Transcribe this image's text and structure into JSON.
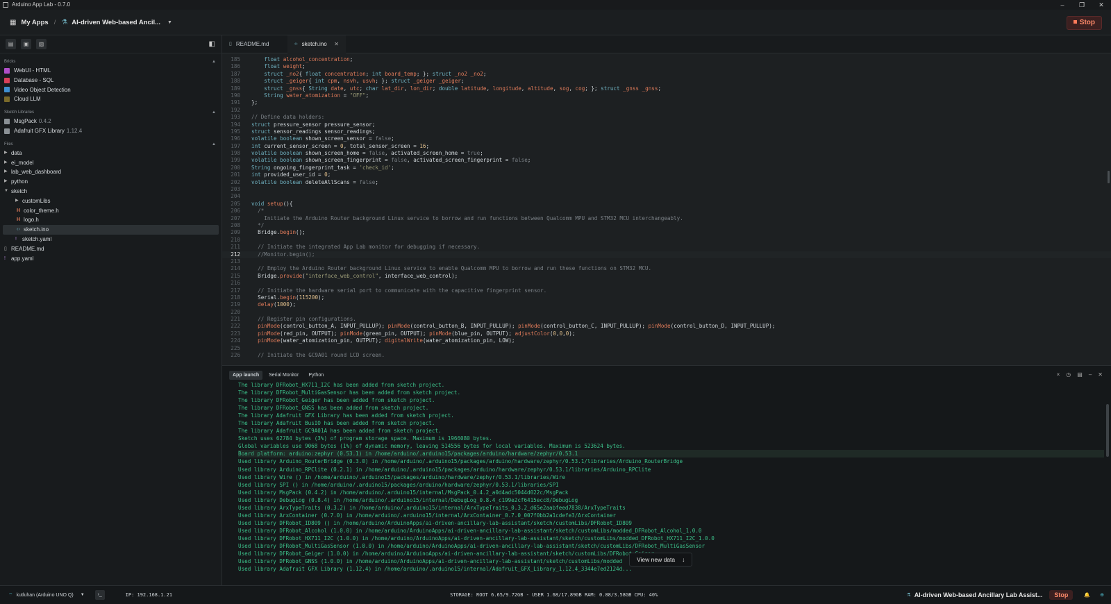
{
  "window": {
    "title": "Arduino App Lab - 0.7.0",
    "minimize": "–",
    "restore": "❐",
    "close": "✕"
  },
  "appbar": {
    "my_apps": "My Apps",
    "separator": "/",
    "app_name": "AI-driven Web-based Ancil...",
    "stop": "Stop"
  },
  "sidebar": {
    "bricks_title": "Bricks",
    "bricks": [
      {
        "label": "WebUI - HTML",
        "color": "#b04fc8"
      },
      {
        "label": "Database - SQL",
        "color": "#d8405a"
      },
      {
        "label": "Video Object Detection",
        "color": "#3f8fd0"
      },
      {
        "label": "Cloud LLM",
        "color": "#7a6a2a"
      }
    ],
    "libs_title": "Sketch Libraries",
    "libs": [
      {
        "name": "MsgPack",
        "version": "0.4.2"
      },
      {
        "name": "Adafruit GFX Library",
        "version": "1.12.4"
      }
    ],
    "files_title": "Files",
    "files": {
      "data": "data",
      "ei_model": "ei_model",
      "lab_web_dashboard": "lab_web_dashboard",
      "python": "python",
      "sketch": "sketch",
      "customLibs": "customLibs",
      "color_theme": "color_theme.h",
      "logo": "logo.h",
      "sketch_ino": "sketch.ino",
      "sketch_yaml": "sketch.yaml",
      "readme": "README.md",
      "app_yaml": "app.yaml"
    }
  },
  "tabs": [
    {
      "label": "README.md"
    },
    {
      "label": "sketch.ino"
    }
  ],
  "code": {
    "first_line": 185,
    "current_line": 212,
    "lines": [
      [
        [
          "    "
        ],
        [
          "float ",
          "k"
        ],
        [
          "alcohol_concentration",
          "fl"
        ],
        [
          ";"
        ]
      ],
      [
        [
          "    "
        ],
        [
          "float ",
          "k"
        ],
        [
          "weight",
          "fl"
        ],
        [
          ";"
        ]
      ],
      [
        [
          "    "
        ],
        [
          "struct ",
          "k"
        ],
        [
          "_no2",
          "fl"
        ],
        [
          "{ "
        ],
        [
          "float ",
          "k"
        ],
        [
          "concentration",
          "fl"
        ],
        [
          "; "
        ],
        [
          "int ",
          "k"
        ],
        [
          "board_temp",
          "fl"
        ],
        [
          "; }; "
        ],
        [
          "struct ",
          "k"
        ],
        [
          "_no2 _no2",
          "fl"
        ],
        [
          ";"
        ]
      ],
      [
        [
          "    "
        ],
        [
          "struct ",
          "k"
        ],
        [
          "_geiger",
          "fl"
        ],
        [
          "{ "
        ],
        [
          "int ",
          "k"
        ],
        [
          "cpm",
          "fl"
        ],
        [
          ", "
        ],
        [
          "nsvh",
          "fl"
        ],
        [
          ", "
        ],
        [
          "usvh",
          "fl"
        ],
        [
          "; }; "
        ],
        [
          "struct ",
          "k"
        ],
        [
          "_geiger _geiger",
          "fl"
        ],
        [
          ";"
        ]
      ],
      [
        [
          "    "
        ],
        [
          "struct ",
          "k"
        ],
        [
          "_gnss",
          "fl"
        ],
        [
          "{ "
        ],
        [
          "String ",
          "k"
        ],
        [
          "date",
          "fl"
        ],
        [
          ", "
        ],
        [
          "utc",
          "fl"
        ],
        [
          "; "
        ],
        [
          "char ",
          "k"
        ],
        [
          "lat_dir",
          "fl"
        ],
        [
          ", "
        ],
        [
          "lon_dir",
          "fl"
        ],
        [
          "; "
        ],
        [
          "double ",
          "k"
        ],
        [
          "latitude",
          "fl"
        ],
        [
          ", "
        ],
        [
          "longitude",
          "fl"
        ],
        [
          ", "
        ],
        [
          "altitude",
          "fl"
        ],
        [
          ", "
        ],
        [
          "sog",
          "fl"
        ],
        [
          ", "
        ],
        [
          "cog",
          "fl"
        ],
        [
          "; }; "
        ],
        [
          "struct ",
          "k"
        ],
        [
          "_gnss _gnss",
          "fl"
        ],
        [
          ";"
        ]
      ],
      [
        [
          "    "
        ],
        [
          "String ",
          "k"
        ],
        [
          "water_atomization",
          "fl"
        ],
        [
          " = "
        ],
        [
          "\"OFF\"",
          "s"
        ],
        [
          ";"
        ]
      ],
      [
        [
          "};"
        ]
      ],
      [
        [
          ""
        ]
      ],
      [
        [
          "// Define data holders:",
          "c"
        ]
      ],
      [
        [
          "struct ",
          "k"
        ],
        [
          "pressure_sensor pressure_sensor;"
        ]
      ],
      [
        [
          "struct ",
          "k"
        ],
        [
          "sensor_readings sensor_readings;"
        ]
      ],
      [
        [
          "volatile boolean ",
          "k"
        ],
        [
          "shown_screen_sensor = "
        ],
        [
          "false",
          "c"
        ],
        [
          ";"
        ]
      ],
      [
        [
          "int ",
          "k"
        ],
        [
          "current_sensor_screen = "
        ],
        [
          "0",
          "n"
        ],
        [
          ", total_sensor_screen = "
        ],
        [
          "16",
          "n"
        ],
        [
          ";"
        ]
      ],
      [
        [
          "volatile boolean ",
          "k"
        ],
        [
          "shown_screen_home = "
        ],
        [
          "false",
          "c"
        ],
        [
          ", activated_screen_home = "
        ],
        [
          "true",
          "c"
        ],
        [
          ";"
        ]
      ],
      [
        [
          "volatile boolean ",
          "k"
        ],
        [
          "shown_screen_fingerprint = "
        ],
        [
          "false",
          "c"
        ],
        [
          ", activated_screen_fingerprint = "
        ],
        [
          "false",
          "c"
        ],
        [
          ";"
        ]
      ],
      [
        [
          "String ",
          "k"
        ],
        [
          "ongoing_fingerprint_task = "
        ],
        [
          "'check_id'",
          "s"
        ],
        [
          ";"
        ]
      ],
      [
        [
          "int ",
          "k"
        ],
        [
          "provided_user_id = "
        ],
        [
          "0",
          "n"
        ],
        [
          ";"
        ]
      ],
      [
        [
          "volatile boolean ",
          "k"
        ],
        [
          "deleteAllScans = "
        ],
        [
          "false",
          "c"
        ],
        [
          ";"
        ]
      ],
      [
        [
          ""
        ]
      ],
      [
        [
          ""
        ]
      ],
      [
        [
          "void ",
          "k"
        ],
        [
          "setup",
          "f"
        ],
        [
          "(){"
        ]
      ],
      [
        [
          "  /*",
          "c"
        ]
      ],
      [
        [
          "    Initiate the Arduino Router background Linux service to borrow and run functions between Qualcomm MPU and STM32 MCU interchangeably.",
          "c"
        ]
      ],
      [
        [
          "  */",
          "c"
        ]
      ],
      [
        [
          "  Bridge."
        ],
        [
          "begin",
          "f"
        ],
        [
          "();"
        ]
      ],
      [
        [
          ""
        ]
      ],
      [
        [
          "  // Initiate the integrated App Lab monitor for debugging if necessary.",
          "c"
        ]
      ],
      [
        [
          "  //Monitor.begin();",
          "c"
        ]
      ],
      [
        [
          ""
        ]
      ],
      [
        [
          "  // Employ the Arduino Router background Linux service to enable Qualcomm MPU to borrow and run these functions on STM32 MCU.",
          "c"
        ]
      ],
      [
        [
          "  Bridge."
        ],
        [
          "provide",
          "f"
        ],
        [
          "("
        ],
        [
          "\"interface_web_control\"",
          "s"
        ],
        [
          ", interface_web_control);"
        ]
      ],
      [
        [
          ""
        ]
      ],
      [
        [
          "  // Initiate the hardware serial port to communicate with the capacitive fingerprint sensor.",
          "c"
        ]
      ],
      [
        [
          "  Serial."
        ],
        [
          "begin",
          "f"
        ],
        [
          "("
        ],
        [
          "115200",
          "n"
        ],
        [
          ");"
        ]
      ],
      [
        [
          "  "
        ],
        [
          "delay",
          "f"
        ],
        [
          "("
        ],
        [
          "1000",
          "n"
        ],
        [
          ");"
        ]
      ],
      [
        [
          ""
        ]
      ],
      [
        [
          "  // Register pin configurations.",
          "c"
        ]
      ],
      [
        [
          "  "
        ],
        [
          "pinMode",
          "f"
        ],
        [
          "(control_button_A, INPUT_PULLUP); "
        ],
        [
          "pinMode",
          "f"
        ],
        [
          "(control_button_B, INPUT_PULLUP); "
        ],
        [
          "pinMode",
          "f"
        ],
        [
          "(control_button_C, INPUT_PULLUP); "
        ],
        [
          "pinMode",
          "f"
        ],
        [
          "(control_button_D, INPUT_PULLUP);"
        ]
      ],
      [
        [
          "  "
        ],
        [
          "pinMode",
          "f"
        ],
        [
          "(red_pin, OUTPUT); "
        ],
        [
          "pinMode",
          "f"
        ],
        [
          "(green_pin, OUTPUT); "
        ],
        [
          "pinMode",
          "f"
        ],
        [
          "(blue_pin, OUTPUT); "
        ],
        [
          "adjustColor",
          "f"
        ],
        [
          "("
        ],
        [
          "0",
          "n"
        ],
        [
          ","
        ],
        [
          "0",
          "n"
        ],
        [
          ","
        ],
        [
          "0",
          "n"
        ],
        [
          ");"
        ]
      ],
      [
        [
          "  "
        ],
        [
          "pinMode",
          "f"
        ],
        [
          "(water_atomization_pin, OUTPUT); "
        ],
        [
          "digitalWrite",
          "f"
        ],
        [
          "(water_atomization_pin, LOW);"
        ]
      ],
      [
        [
          ""
        ]
      ],
      [
        [
          "  // Initiate the GC9A01 round LCD screen.",
          "c"
        ]
      ]
    ]
  },
  "panel": {
    "tabs": [
      "App launch",
      "Serial Monitor",
      "Python"
    ],
    "controls": {
      "clear": "×",
      "history": "◷",
      "layout": "▤",
      "minimize": "–",
      "close": "✕"
    },
    "highlight_index": 10,
    "log": [
      "The library DFRobot_HX711_I2C has been added from sketch project.",
      "The library DFRobot_MultiGasSensor has been added from sketch project.",
      "The library DFRobot_Geiger has been added from sketch project.",
      "The library DFRobot_GNSS has been added from sketch project.",
      "The library Adafruit GFX Library has been added from sketch project.",
      "The library Adafruit BusIO has been added from sketch project.",
      "The library Adafruit GC9A01A has been added from sketch project.",
      "Sketch uses 62784 bytes (3%) of program storage space. Maximum is 1966080 bytes.",
      "Global variables use 9068 bytes (1%) of dynamic memory, leaving 514556 bytes for local variables. Maximum is 523624 bytes.",
      "Board platform: arduino:zephyr (0.53.1) in /home/arduino/.arduino15/packages/arduino/hardware/zephyr/0.53.1",
      "Used library Arduino_RouterBridge (0.3.0) in /home/arduino/.arduino15/packages/arduino/hardware/zephyr/0.53.1/libraries/Arduino_RouterBridge",
      "Used library Arduino_RPClite (0.2.1) in /home/arduino/.arduino15/packages/arduino/hardware/zephyr/0.53.1/libraries/Arduino_RPClite",
      "Used library Wire () in /home/arduino/.arduino15/packages/arduino/hardware/zephyr/0.53.1/libraries/Wire",
      "Used library SPI () in /home/arduino/.arduino15/packages/arduino/hardware/zephyr/0.53.1/libraries/SPI",
      "Used library MsgPack (0.4.2) in /home/arduino/.arduino15/internal/MsgPack_0.4.2_a0d4adc5044d022c/MsgPack",
      "Used library DebugLog (0.8.4) in /home/arduino/.arduino15/internal/DebugLog_0.8.4_c199e2cf6415ecc8/DebugLog",
      "Used library ArxTypeTraits (0.3.2) in /home/arduino/.arduino15/internal/ArxTypeTraits_0.3.2_d65e2aabfeed7838/ArxTypeTraits",
      "Used library ArxContainer (0.7.0) in /home/arduino/.arduino15/internal/ArxContainer_0.7.0_007f0bb2a1cdefe3/ArxContainer",
      "Used library DFRobot_ID809 () in /home/arduino/ArduinoApps/ai-driven-ancillary-lab-assistant/sketch/customLibs/DFRobot_ID809",
      "Used library DFRobot_Alcohol (1.0.0) in /home/arduino/ArduinoApps/ai-driven-ancillary-lab-assistant/sketch/customLibs/modded_DFRobot_Alcohol_1.0.0",
      "Used library DFRobot_HX711_I2C (1.0.0) in /home/arduino/ArduinoApps/ai-driven-ancillary-lab-assistant/sketch/customLibs/modded_DFRobot_HX711_I2C_1.0.0",
      "Used library DFRobot_MultiGasSensor (1.0.0) in /home/arduino/ArduinoApps/ai-driven-ancillary-lab-assistant/sketch/customLibs/DFRobot_MultiGasSensor",
      "Used library DFRobot_Geiger (1.0.0) in /home/arduino/ArduinoApps/ai-driven-ancillary-lab-assistant/sketch/customLibs/DFRobot_Geiger",
      "Used library DFRobot_GNSS (1.0.0) in /home/arduino/ArduinoApps/ai-driven-ancillary-lab-assistant/sketch/customLibs/modded",
      "Used library Adafruit GFX Library (1.12.4) in /home/arduino/.arduino15/internal/Adafruit_GFX_Library_1.12.4_3344e7ed2124d..."
    ],
    "view_new_data": "View new data"
  },
  "status": {
    "board": "kutluhan (Arduino UNO Q)",
    "ip": "IP: 192.168.1.21",
    "resources": "STORAGE: ROOT 6.65/9.72GB - USER 1.68/17.89GB  RAM: 0.88/3.58GB  CPU: 40%",
    "app_name": "AI-driven Web-based Ancillary Lab Assist...",
    "stop": "Stop"
  }
}
